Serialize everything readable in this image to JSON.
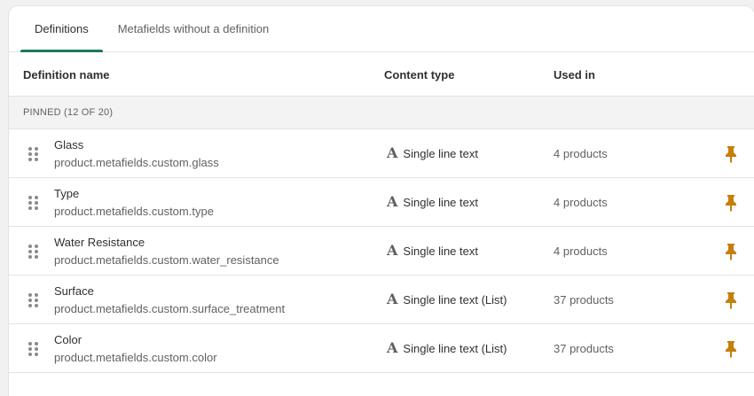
{
  "tabs": [
    {
      "label": "Definitions",
      "active": true
    },
    {
      "label": "Metafields without a definition",
      "active": false
    }
  ],
  "columns": {
    "name": "Definition name",
    "content_type": "Content type",
    "used_in": "Used in"
  },
  "section": {
    "label": "PINNED (12 OF 20)"
  },
  "rows": [
    {
      "name": "Glass",
      "key": "product.metafields.custom.glass",
      "content_type": "Single line text",
      "used_in": "4 products"
    },
    {
      "name": "Type",
      "key": "product.metafields.custom.type",
      "content_type": "Single line text",
      "used_in": "4 products"
    },
    {
      "name": "Water Resistance",
      "key": "product.metafields.custom.water_resistance",
      "content_type": "Single line text",
      "used_in": "4 products"
    },
    {
      "name": "Surface",
      "key": "product.metafields.custom.surface_treatment",
      "content_type": "Single line text (List)",
      "used_in": "37 products"
    },
    {
      "name": "Color",
      "key": "product.metafields.custom.color",
      "content_type": "Single line text (List)",
      "used_in": "37 products"
    }
  ],
  "icons": {
    "drag": "drag-handle-icon",
    "content_type": "text-type-icon",
    "pin": "pin-icon"
  },
  "colors": {
    "accent": "#1a7a5a",
    "pin": "#c57f0b"
  }
}
